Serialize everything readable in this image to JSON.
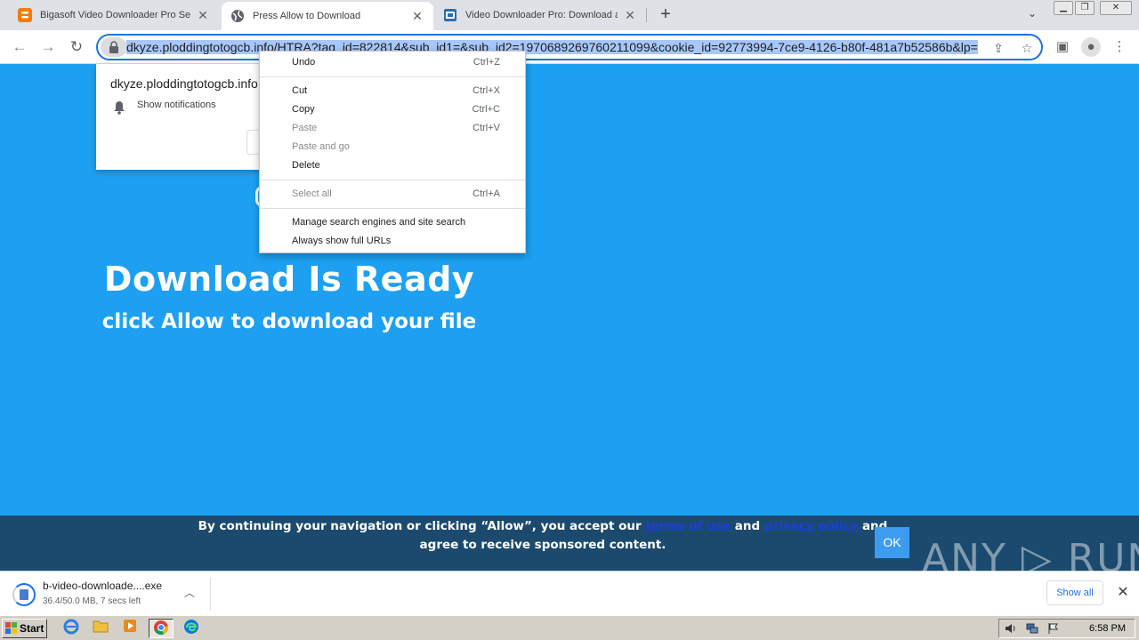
{
  "tabs": [
    {
      "title": "Bigasoft Video Downloader Pro Serial",
      "favicon": "blogger-icon",
      "active": false
    },
    {
      "title": "Press Allow to Download",
      "favicon": "globe-icon",
      "active": true
    },
    {
      "title": "Video Downloader Pro: Download and",
      "favicon": "app-icon",
      "active": false
    }
  ],
  "omnibox": {
    "url": "dkyze.ploddingtotogcb.info/HTRA?tag_id=822814&sub_id1=&sub_id2=1970689269760211099&cookie_id=92773994-7ce9-4126-b80f-481a7b52586b&lp="
  },
  "permission_prompt": {
    "origin": "dkyze.ploddingtotogcb.info",
    "permission": "Show notifications"
  },
  "context_menu": {
    "items": [
      {
        "label": "Undo",
        "shortcut": "Ctrl+Z",
        "disabled": false
      },
      {
        "label": "Cut",
        "shortcut": "Ctrl+X",
        "disabled": false
      },
      {
        "label": "Copy",
        "shortcut": "Ctrl+C",
        "disabled": false
      },
      {
        "label": "Paste",
        "shortcut": "Ctrl+V",
        "disabled": true
      },
      {
        "label": "Paste and go",
        "shortcut": "",
        "disabled": true
      },
      {
        "label": "Delete",
        "shortcut": "",
        "disabled": false
      },
      {
        "label": "Select all",
        "shortcut": "Ctrl+A",
        "disabled": true
      },
      {
        "label": "Manage search engines and site search",
        "shortcut": "",
        "disabled": false
      },
      {
        "label": "Always show full URLs",
        "shortcut": "",
        "disabled": false
      }
    ]
  },
  "page": {
    "headline": "Download Is Ready",
    "subheadline": "click Allow to download your file",
    "background_color": "#1da0f2"
  },
  "consent": {
    "text_before": "By continuing your navigation or clicking “Allow”, you accept our ",
    "terms_link": "terms of use ",
    "text_middle": "and ",
    "privacy_link": "privacy policy ",
    "text_after": "and agree to receive sponsored content.",
    "ok_label": "OK"
  },
  "download": {
    "filename": "b-video-downloade....exe",
    "status": "36.4/50.0 MB, 7 secs left",
    "progress_fraction": 0.728,
    "show_all_label": "Show all"
  },
  "watermark": "ANY RUN",
  "taskbar": {
    "start_label": "Start",
    "clock": "6:58 PM",
    "apps": [
      "ie-icon",
      "folder-icon",
      "media-player-icon",
      "chrome-icon",
      "edge-icon"
    ]
  }
}
